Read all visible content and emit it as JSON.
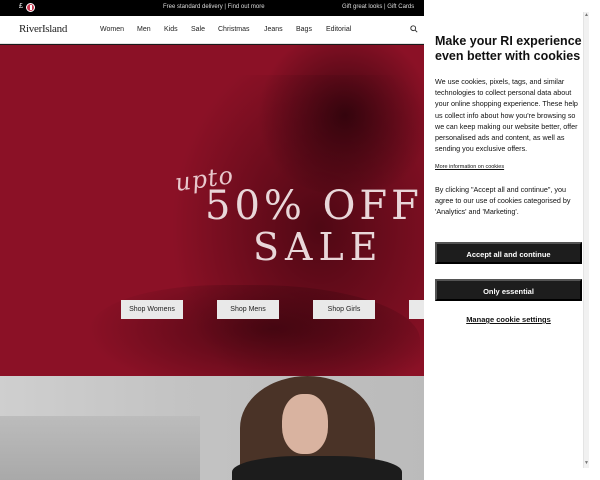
{
  "topbar": {
    "currency": "£",
    "promo": "Free standard delivery | Find out more",
    "right": "Gift great looks | Gift Cards"
  },
  "nav": {
    "logo": "RiverIsland",
    "items": [
      "Women",
      "Men",
      "Kids",
      "Sale",
      "Christmas",
      "Jeans",
      "Bags",
      "Editorial"
    ]
  },
  "hero": {
    "upto": "upto",
    "offer": "50% OFF",
    "sale": "SALE",
    "buttons": [
      "Shop Womens",
      "Shop Mens",
      "Shop Girls",
      ""
    ]
  },
  "cookie": {
    "title": "Make your RI experience even better with cookies",
    "body": "We use cookies, pixels, tags, and similar technologies to collect personal data about your online shopping experience. These help us collect info about how you're browsing so we can keep making our website better, offer personalised ads and content, as well as sending you exclusive offers.",
    "more_link": "More information on cookies",
    "body2": "By clicking \"Accept all and continue\", you agree to our use of cookies categorised by 'Analytics' and 'Marketing'.",
    "accept_label": "Accept all and continue",
    "essential_label": "Only essential",
    "manage_label": "Manage cookie settings"
  },
  "colors": {
    "hero_bg": "#8b1126",
    "button_dark": "#1d1d1d"
  }
}
